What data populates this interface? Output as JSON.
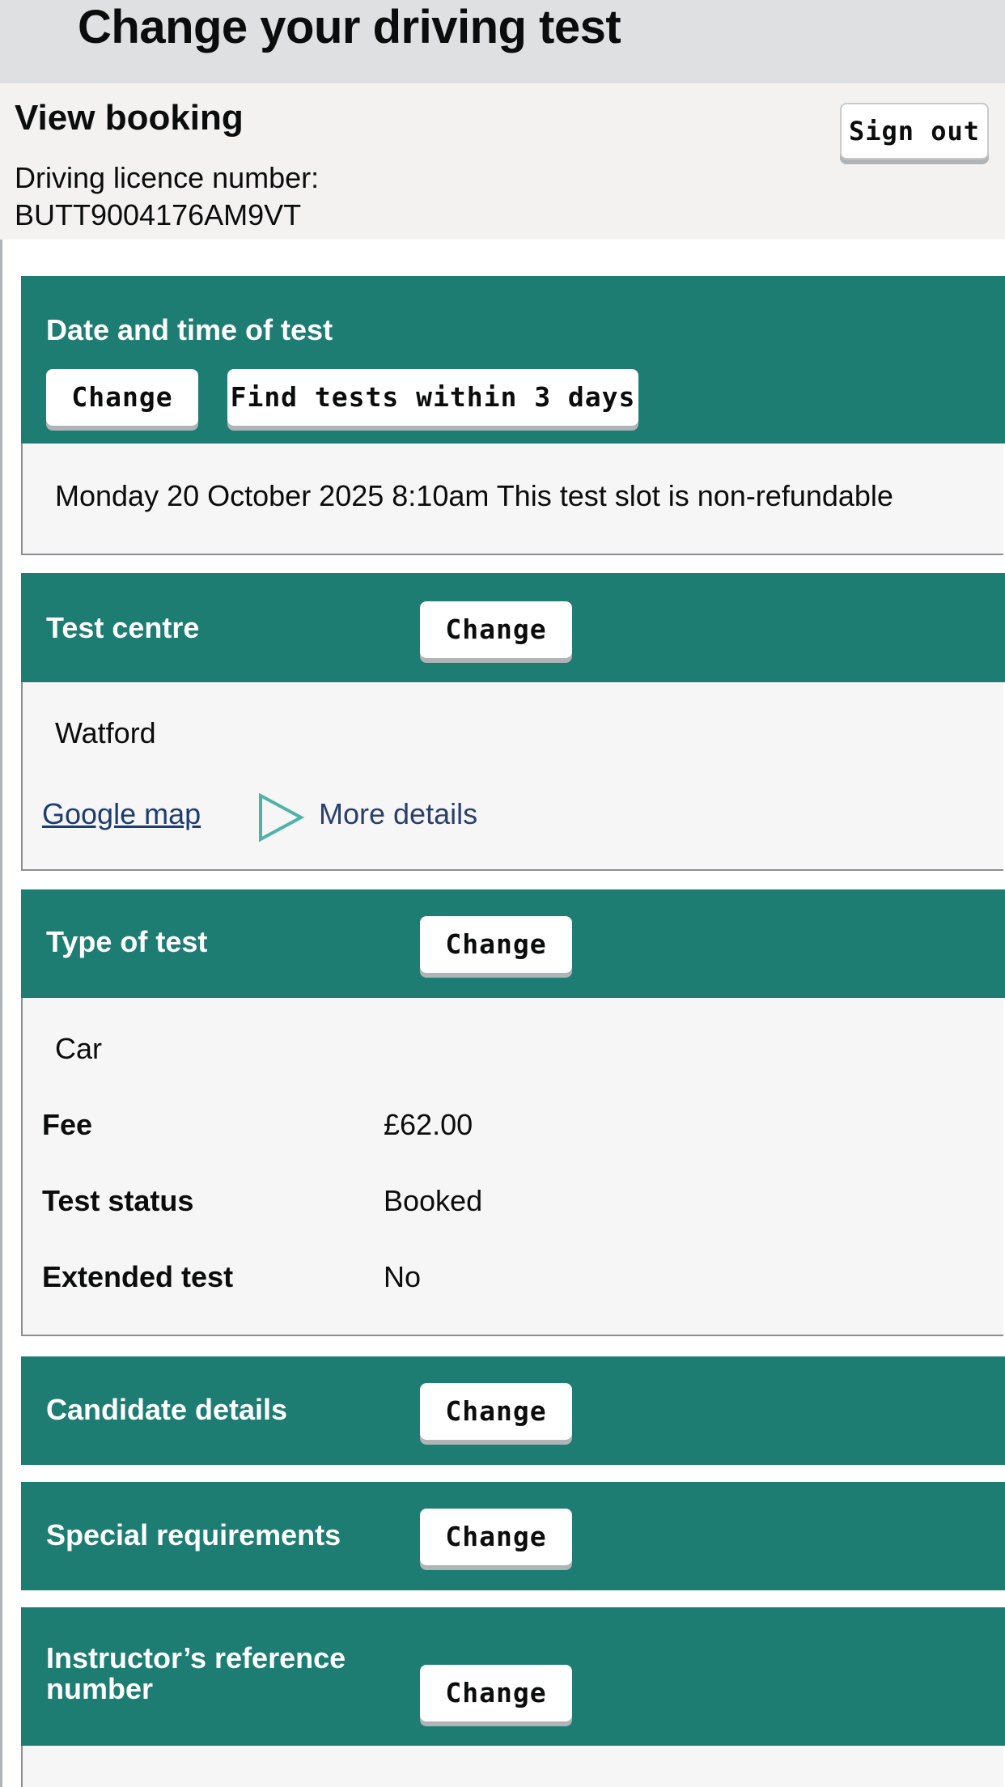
{
  "header": {
    "title": "Change your driving test"
  },
  "booking": {
    "heading": "View booking",
    "licence_label": "Driving licence number:",
    "licence_number": "BUTT9004176AM9VT",
    "sign_out_label": "Sign out"
  },
  "sections": {
    "date_time": {
      "title": "Date and time of test",
      "change_label": "Change",
      "find_label": "Find tests within 3 days",
      "value": "Monday 20 October 2025 8:10am  This test slot is non-refundable"
    },
    "test_centre": {
      "title": "Test centre",
      "change_label": "Change",
      "value": "Watford",
      "map_link": "Google map",
      "more_details": "More details"
    },
    "type_of_test": {
      "title": "Type of test",
      "change_label": "Change",
      "value": "Car",
      "rows": [
        {
          "label": "Fee",
          "value": "£62.00"
        },
        {
          "label": "Test status",
          "value": "Booked"
        },
        {
          "label": "Extended test",
          "value": "No"
        }
      ]
    },
    "candidate": {
      "title": "Candidate details",
      "change_label": "Change"
    },
    "special": {
      "title": "Special requirements",
      "change_label": "Change"
    },
    "instructor": {
      "title_line1": "Instructor’s reference",
      "title_line2": "number",
      "change_label": "Change"
    }
  },
  "colors": {
    "section_header": "#1d7d73",
    "top_bar": "#dee0e2",
    "link": "#1d3d70"
  }
}
